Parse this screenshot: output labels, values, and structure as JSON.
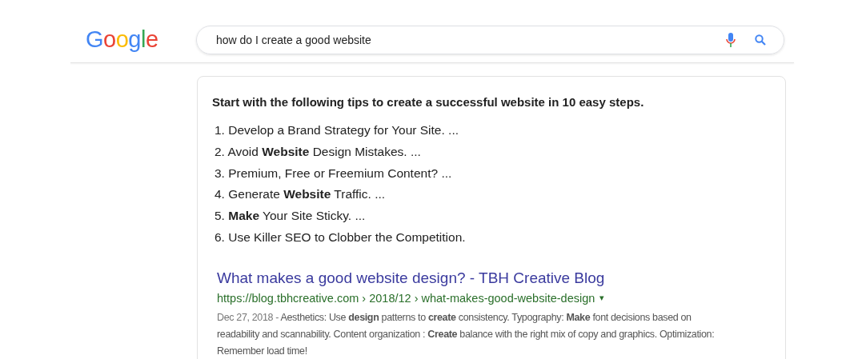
{
  "logo": "Google",
  "search": {
    "value": "how do I create a good website"
  },
  "snippet": {
    "heading": "Start with the following tips to create a successful website in 10 easy steps.",
    "items": [
      "1. Develop a Brand Strategy for Your Site. ...",
      "2. Avoid **Website** Design Mistakes. ...",
      "3. Premium, Free or Freemium Content? ...",
      "4. Generate **Website** Traffic. ...",
      "5. **Make** Your Site Sticky. ...",
      "6. Use Killer SEO to Clobber the Competition."
    ]
  },
  "result": {
    "title": "What makes a good website design? - TBH Creative Blog",
    "url": "https://blog.tbhcreative.com › 2018/12 › what-makes-good-website-design",
    "caret": "▾",
    "date": "Dec 27, 2018 - ",
    "description": "Aesthetics: Use **design** patterns to **create** consistency. Typography: **Make** font decisions based on readability and scannability. Content organization : **Create** balance with the right mix of copy and graphics. Optimization: Remember load time!"
  }
}
